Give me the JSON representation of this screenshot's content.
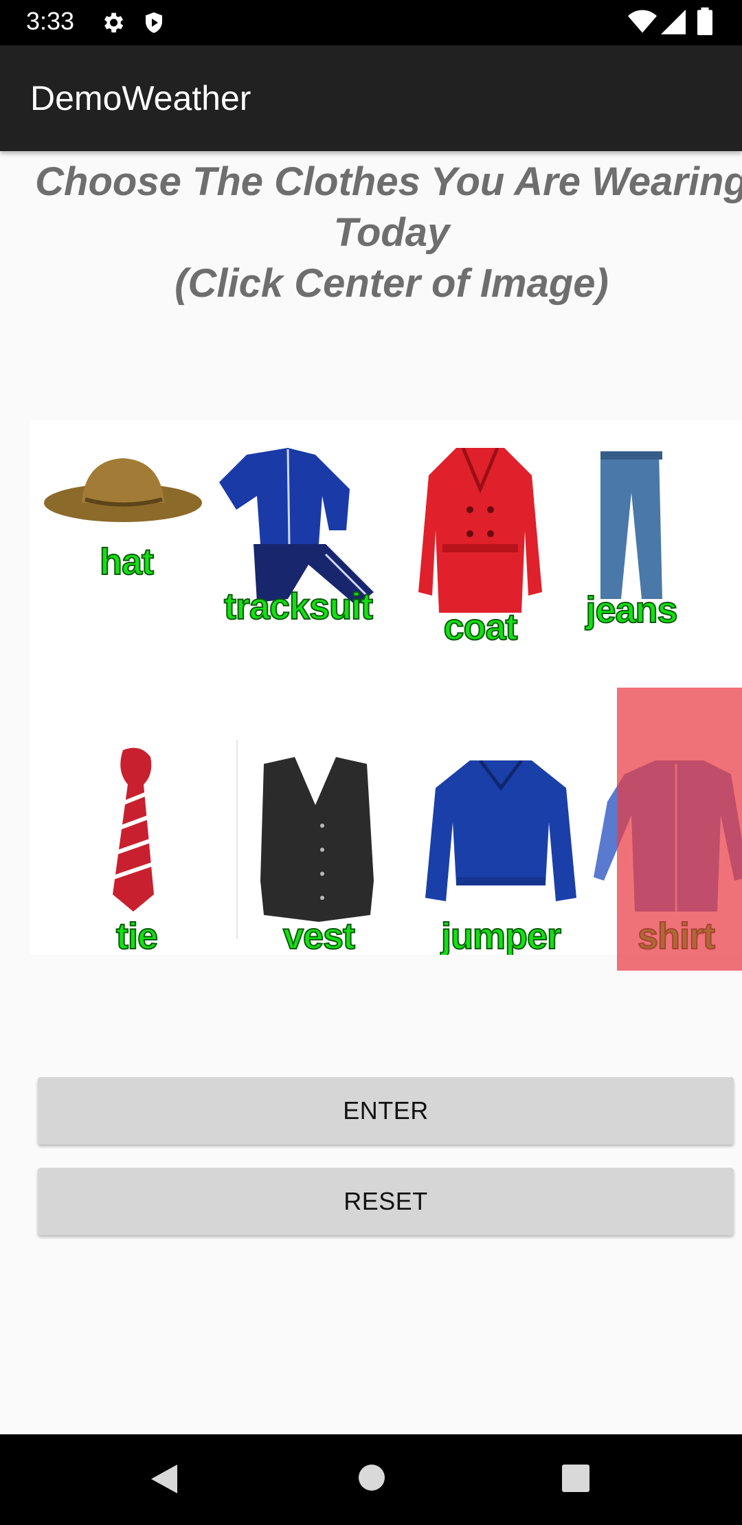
{
  "status_bar": {
    "time": "3:33",
    "icons": [
      "gear-icon",
      "shield-play-icon",
      "wifi-icon",
      "signal-icon",
      "battery-icon"
    ]
  },
  "app_bar": {
    "title": "DemoWeather"
  },
  "heading": {
    "line1": "Choose The Clothes You Are Wearing",
    "line2": "Today",
    "line3": "(Click Center of Image)"
  },
  "clothes": [
    {
      "label": "hat"
    },
    {
      "label": "tracksuit"
    },
    {
      "label": "coat"
    },
    {
      "label": "jeans"
    },
    {
      "label": "tie"
    },
    {
      "label": "vest"
    },
    {
      "label": "jumper"
    },
    {
      "label": "shirt"
    }
  ],
  "buttons": {
    "enter": "ENTER",
    "reset": "RESET"
  },
  "nav_bar": {
    "icons": [
      "back-icon",
      "home-icon",
      "recents-icon"
    ]
  },
  "colors": {
    "app_bar": "#212121",
    "label_green": "#14e014",
    "selection_highlight": "#e83c42",
    "button": "#d6d6d6"
  }
}
